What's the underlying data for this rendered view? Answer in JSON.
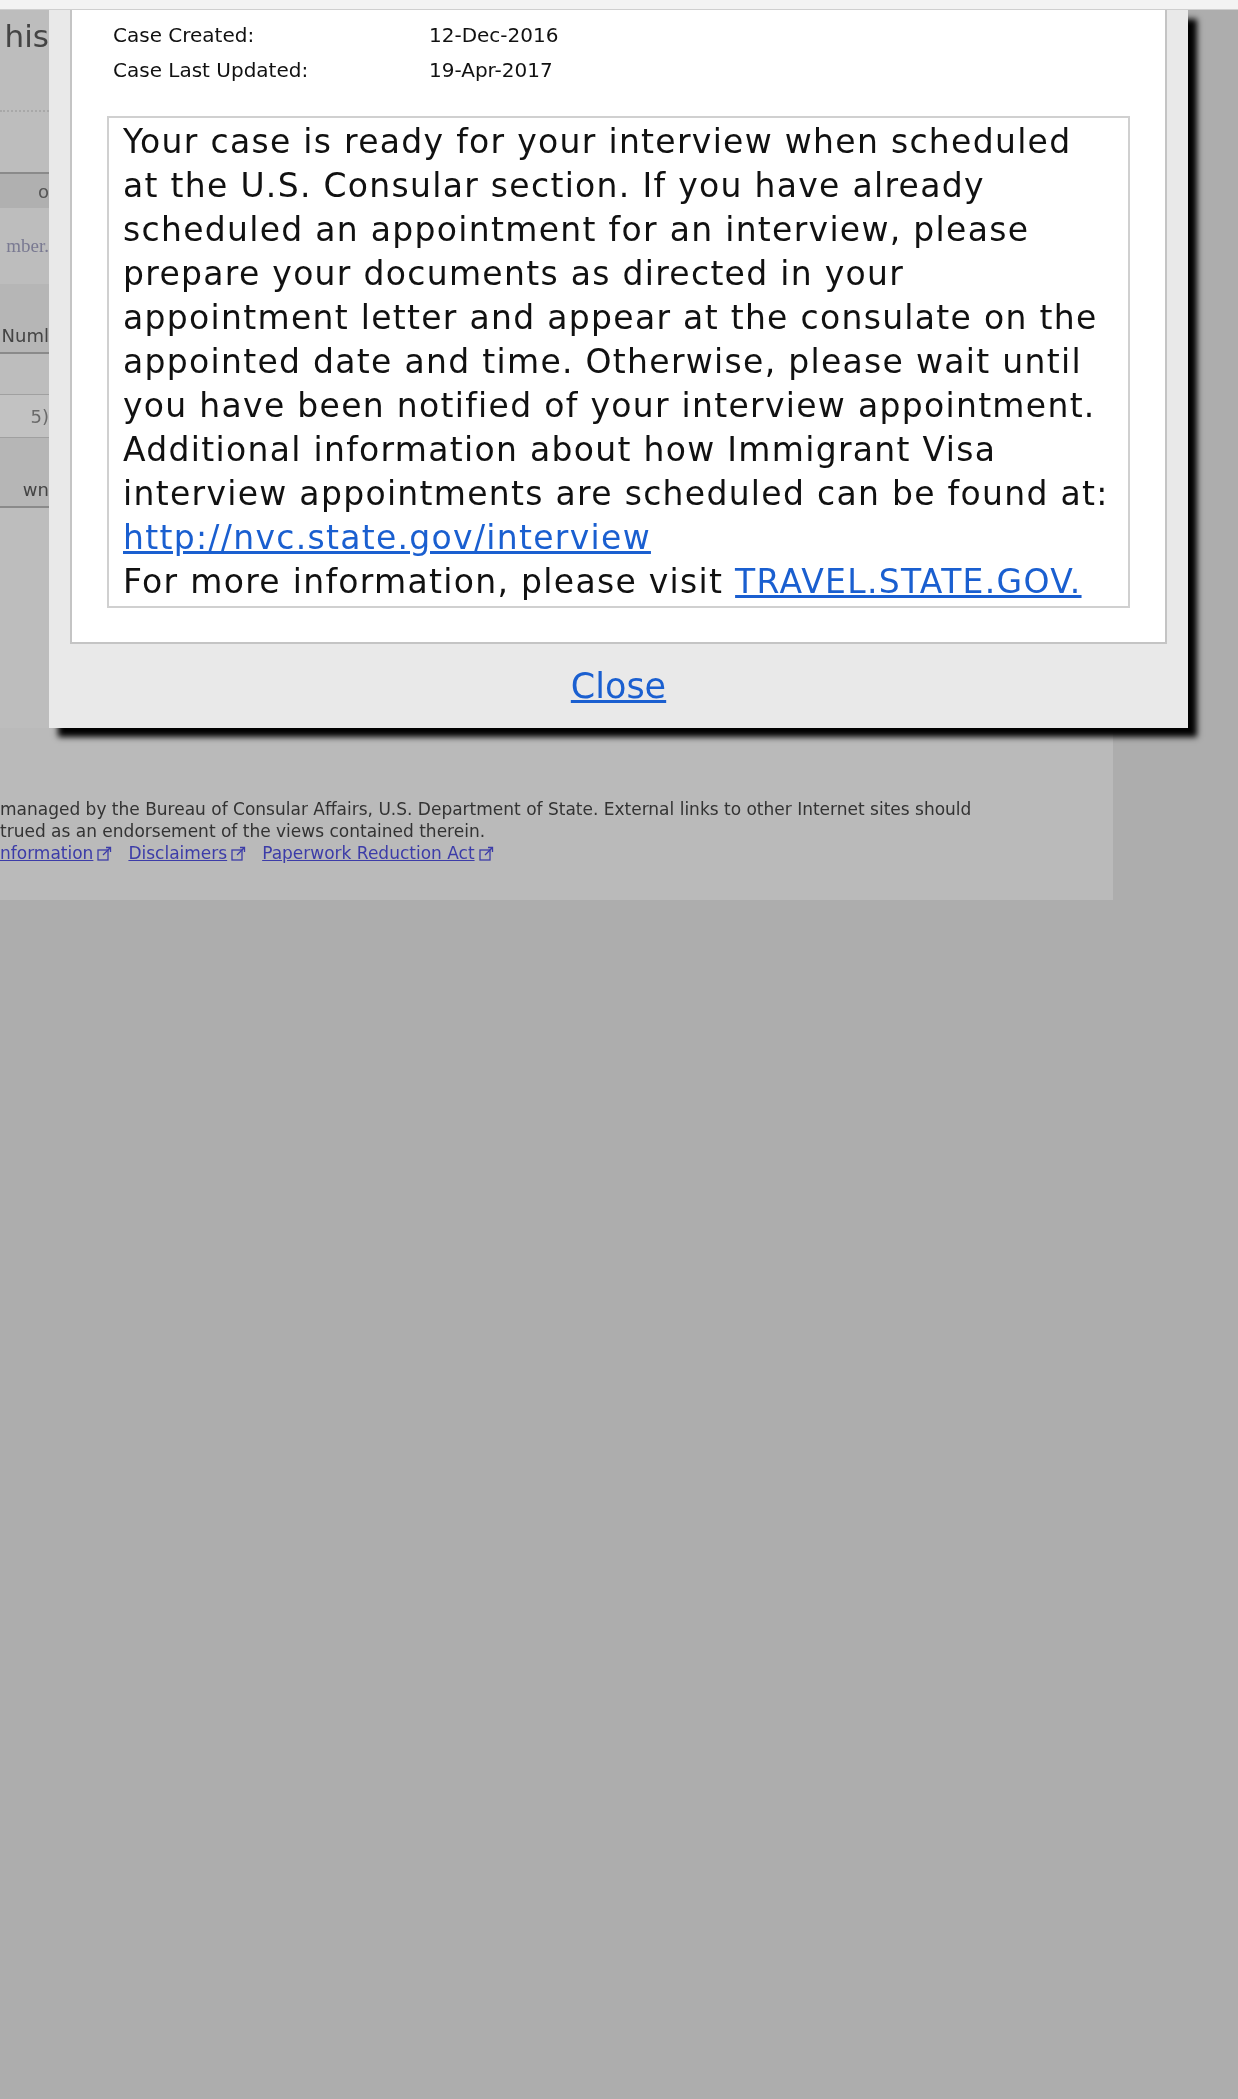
{
  "background_page": {
    "heading": "his",
    "fields": [
      {
        "kind": "button",
        "text": "o"
      },
      {
        "kind": "placeholder",
        "text": "mber."
      },
      {
        "kind": "field",
        "text": "Numl"
      },
      {
        "kind": "disabled",
        "text": "5)"
      },
      {
        "kind": "field",
        "text": "wn"
      }
    ]
  },
  "dialog": {
    "details": [
      {
        "label": "Case Created:",
        "value": "12-Dec-2016"
      },
      {
        "label": "Case Last Updated:",
        "value": "19-Apr-2017"
      }
    ],
    "message": {
      "text": "Your case is ready for your interview when scheduled at the U.S. Consular section. If you have already scheduled an appointment for an interview, please prepare your documents as directed in your appointment letter and appear at the consulate on the appointed date and time. Otherwise, please wait until you have been notified of your interview appointment. Additional information about how Immigrant Visa interview appointments are scheduled can be found at:",
      "link": "http://nvc.state.gov/interview"
    },
    "more_info": {
      "text": "For more information, please visit",
      "link": "TRAVEL.STATE.GOV."
    },
    "close": "Close"
  },
  "footer": {
    "lines": [
      "managed by the Bureau of Consular Affairs, U.S. Department of State. External links to other Internet sites should",
      "trued as an endorsement of the views contained therein."
    ],
    "links": [
      "nformation",
      "Disclaimers",
      "Paperwork Reduction Act"
    ]
  }
}
